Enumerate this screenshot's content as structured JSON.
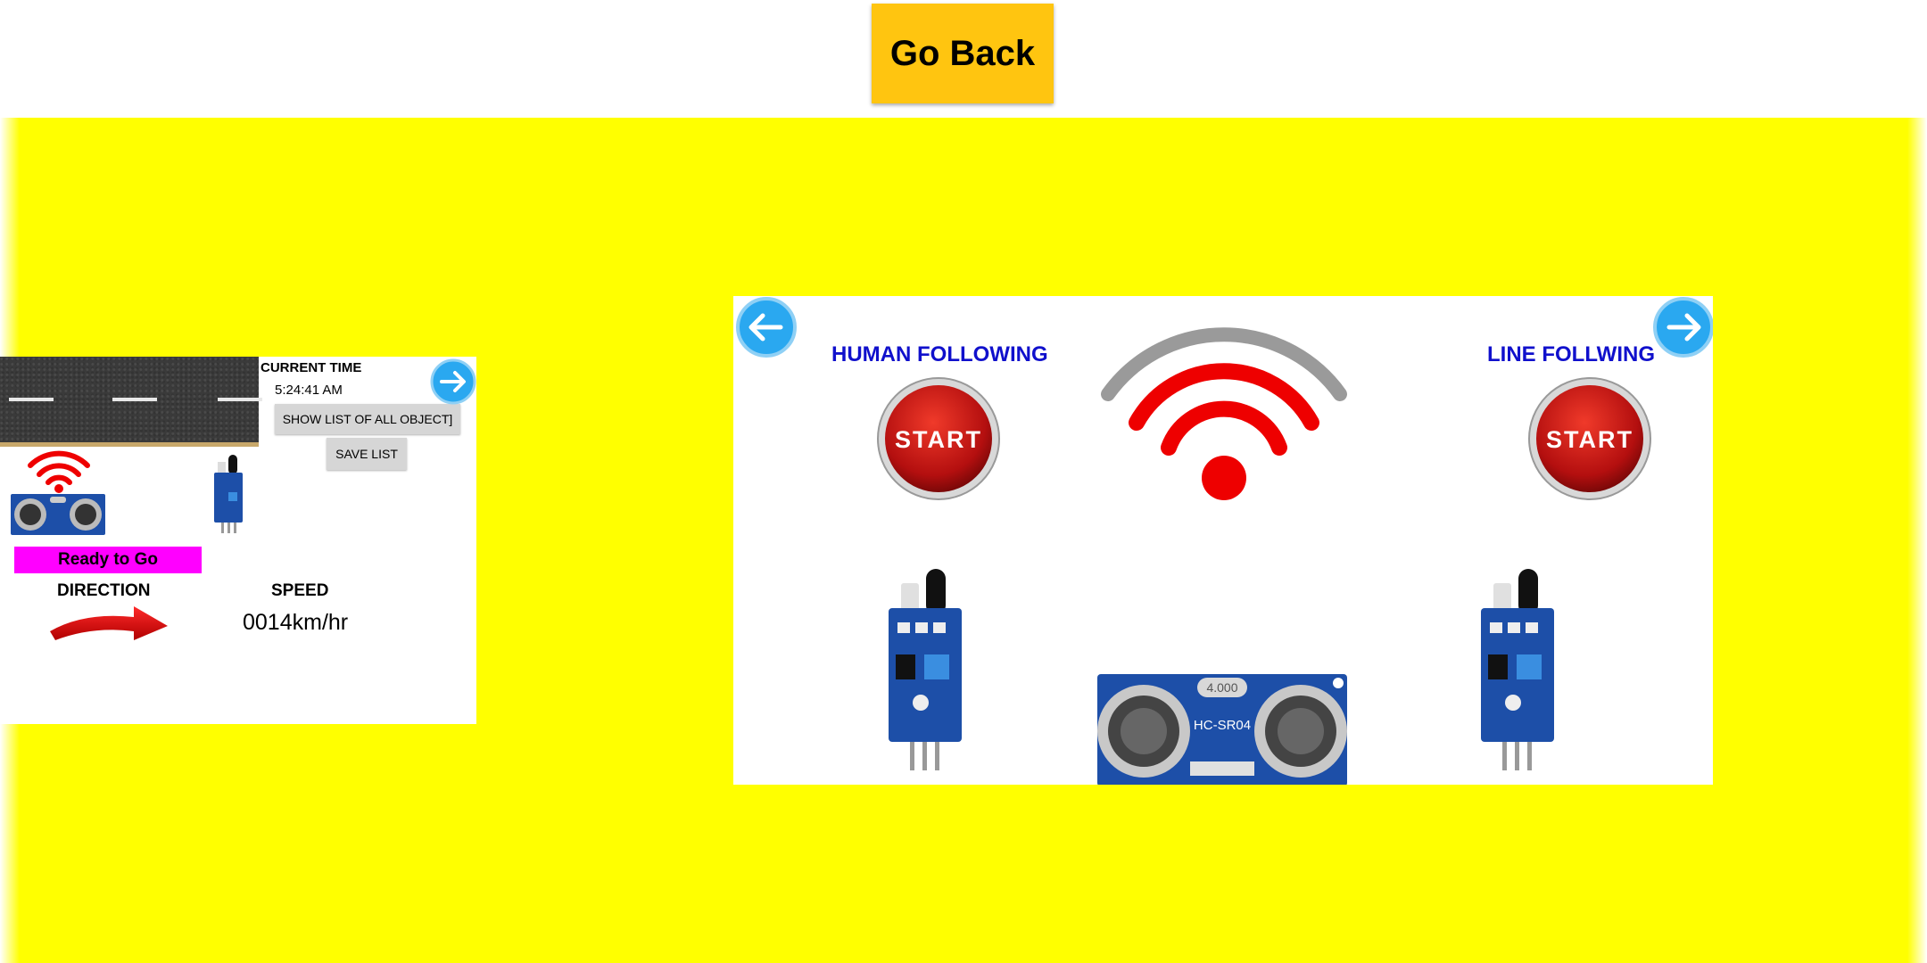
{
  "header": {
    "go_back_label": "Go Back"
  },
  "mini_panel": {
    "current_time_label": "CURRENT TIME",
    "current_time": "5:24:41 AM",
    "show_list_button": "SHOW LIST OF ALL OBJECT]",
    "save_list_button": "SAVE LIST",
    "status": "Ready to Go",
    "direction_label": "DIRECTION",
    "speed_label": "SPEED",
    "speed_value": "0014km/hr"
  },
  "main_panel": {
    "left_mode_title": "HUMAN FOLLOWING",
    "right_mode_title": "LINE FOLLWING",
    "start_label": "START",
    "sensor_model_label": "HC-SR04",
    "crystal_label": "4.000"
  },
  "colors": {
    "background_yellow": "#ffff00",
    "go_back_button": "#ffc510",
    "status_magenta": "#ff00ff",
    "title_blue": "#1010cc",
    "wifi_red": "#ee0000",
    "arrow_blue": "#2aa8f0"
  },
  "icons": {
    "nav_left": "arrow-left-icon",
    "nav_right": "arrow-right-icon",
    "wifi": "wifi-icon",
    "direction": "curved-arrow-right-icon"
  }
}
